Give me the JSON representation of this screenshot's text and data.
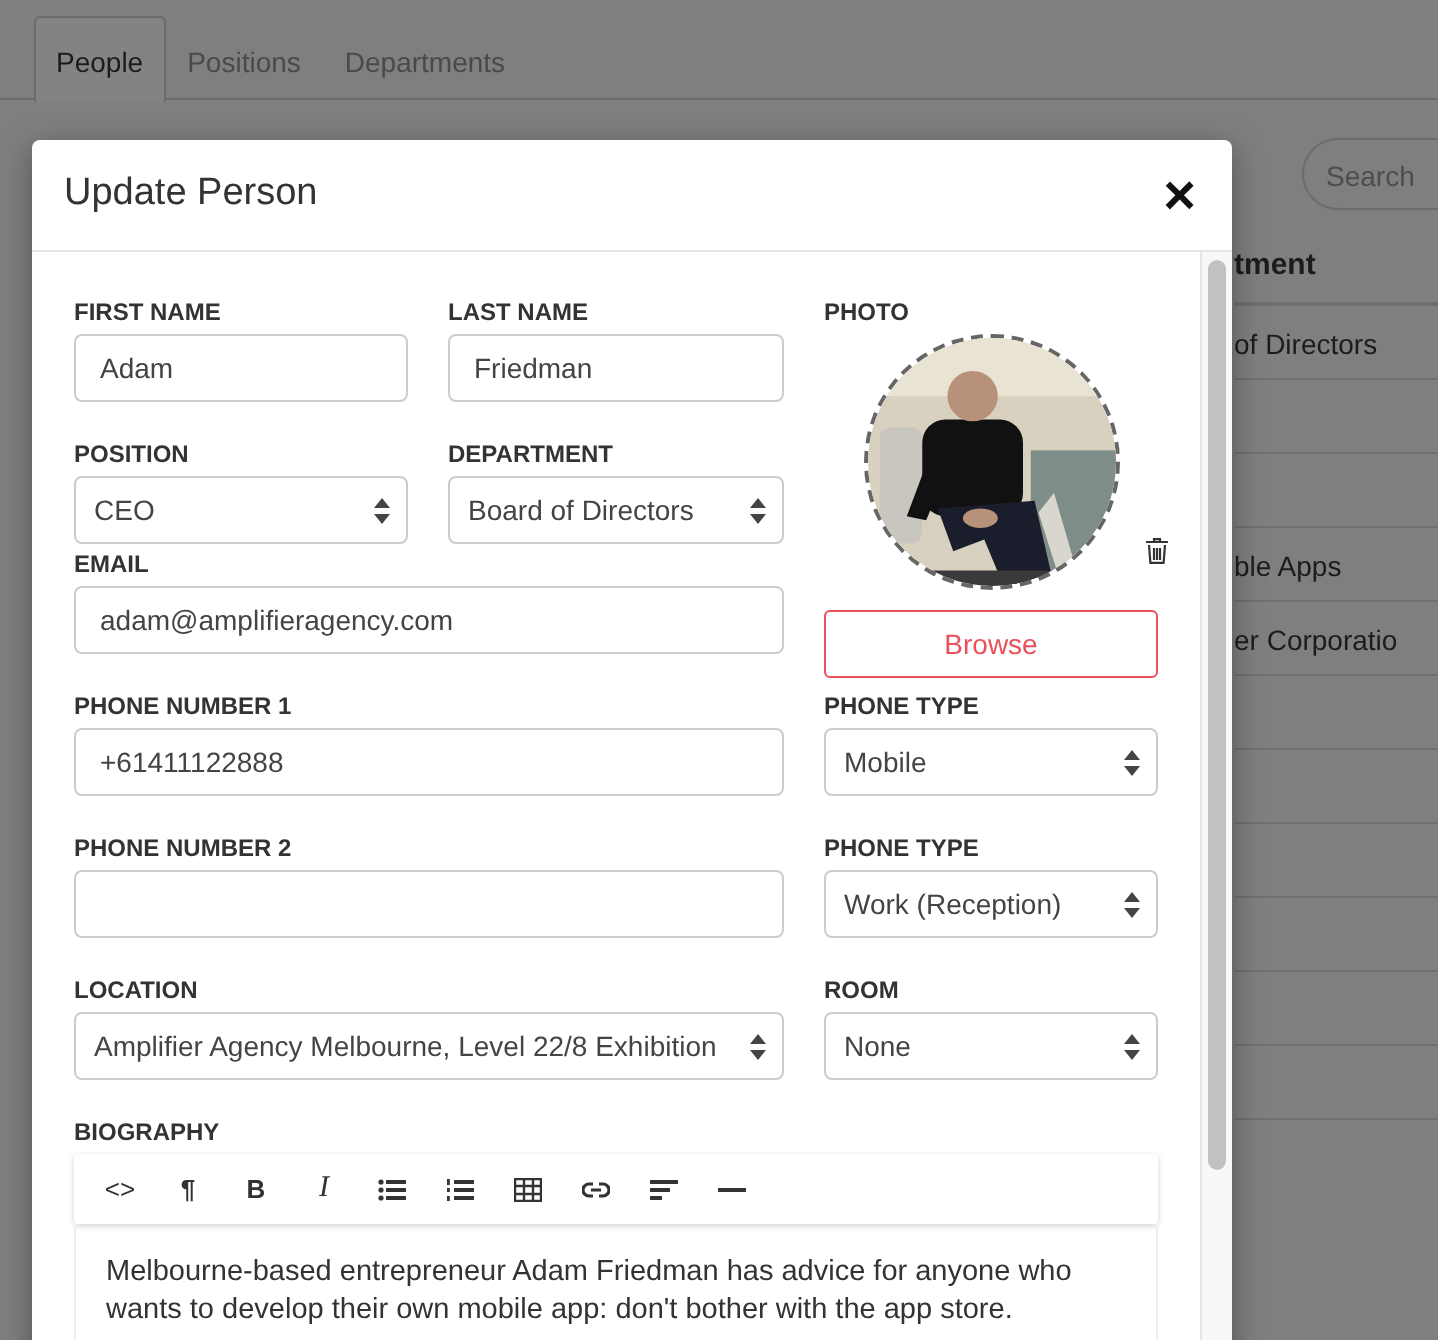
{
  "background_page": {
    "tabs": [
      {
        "label": "People",
        "selected": true
      },
      {
        "label": "Positions",
        "selected": false
      },
      {
        "label": "Departments",
        "selected": false
      }
    ],
    "search": {
      "placeholder": "Search"
    },
    "table": {
      "columns": [
        "tment"
      ],
      "rows": [
        {
          "column_1": "of Directors"
        },
        {},
        {},
        {
          "column_1": "ble Apps"
        },
        {
          "column_1": "er Corporatio"
        },
        {},
        {},
        {},
        {},
        {},
        {}
      ]
    }
  },
  "modal": {
    "title": "Update Person",
    "close": "×",
    "fields": [
      {
        "label": "FIRST NAME",
        "kind": "text",
        "value": "Adam"
      },
      {
        "label": "LAST NAME",
        "kind": "text",
        "value": "Friedman"
      },
      {
        "label": "POSITION",
        "kind": "select",
        "value": "CEO"
      },
      {
        "label": "DEPARTMENT",
        "kind": "select",
        "value": "Board of Directors"
      },
      {
        "label": "EMAIL",
        "kind": "text",
        "value": "adam@amplifieragency.com"
      },
      {
        "label": "PHONE NUMBER 1",
        "kind": "text",
        "value": "+61411122888"
      },
      {
        "label": "PHONE TYPE",
        "kind": "select",
        "value": "Mobile"
      },
      {
        "label": "PHONE NUMBER 2",
        "kind": "text"
      },
      {
        "label": "PHONE TYPE",
        "kind": "select",
        "value": "Work (Reception)"
      },
      {
        "label": "LOCATION",
        "kind": "select",
        "value": "Amplifier Agency Melbourne, Level 22/8 Exhibition"
      },
      {
        "label": "ROOM",
        "kind": "select",
        "value": "None"
      }
    ],
    "photo": {
      "label": "PHOTO",
      "button": "Browse"
    },
    "biography": {
      "label": "BIOGRAPHY",
      "toolbar": [
        "<>",
        "¶",
        "B",
        "I"
      ],
      "text": "Melbourne-based entrepreneur Adam Friedman has advice for anyone who wants to develop their own mobile app: don't bother with the app store."
    }
  }
}
